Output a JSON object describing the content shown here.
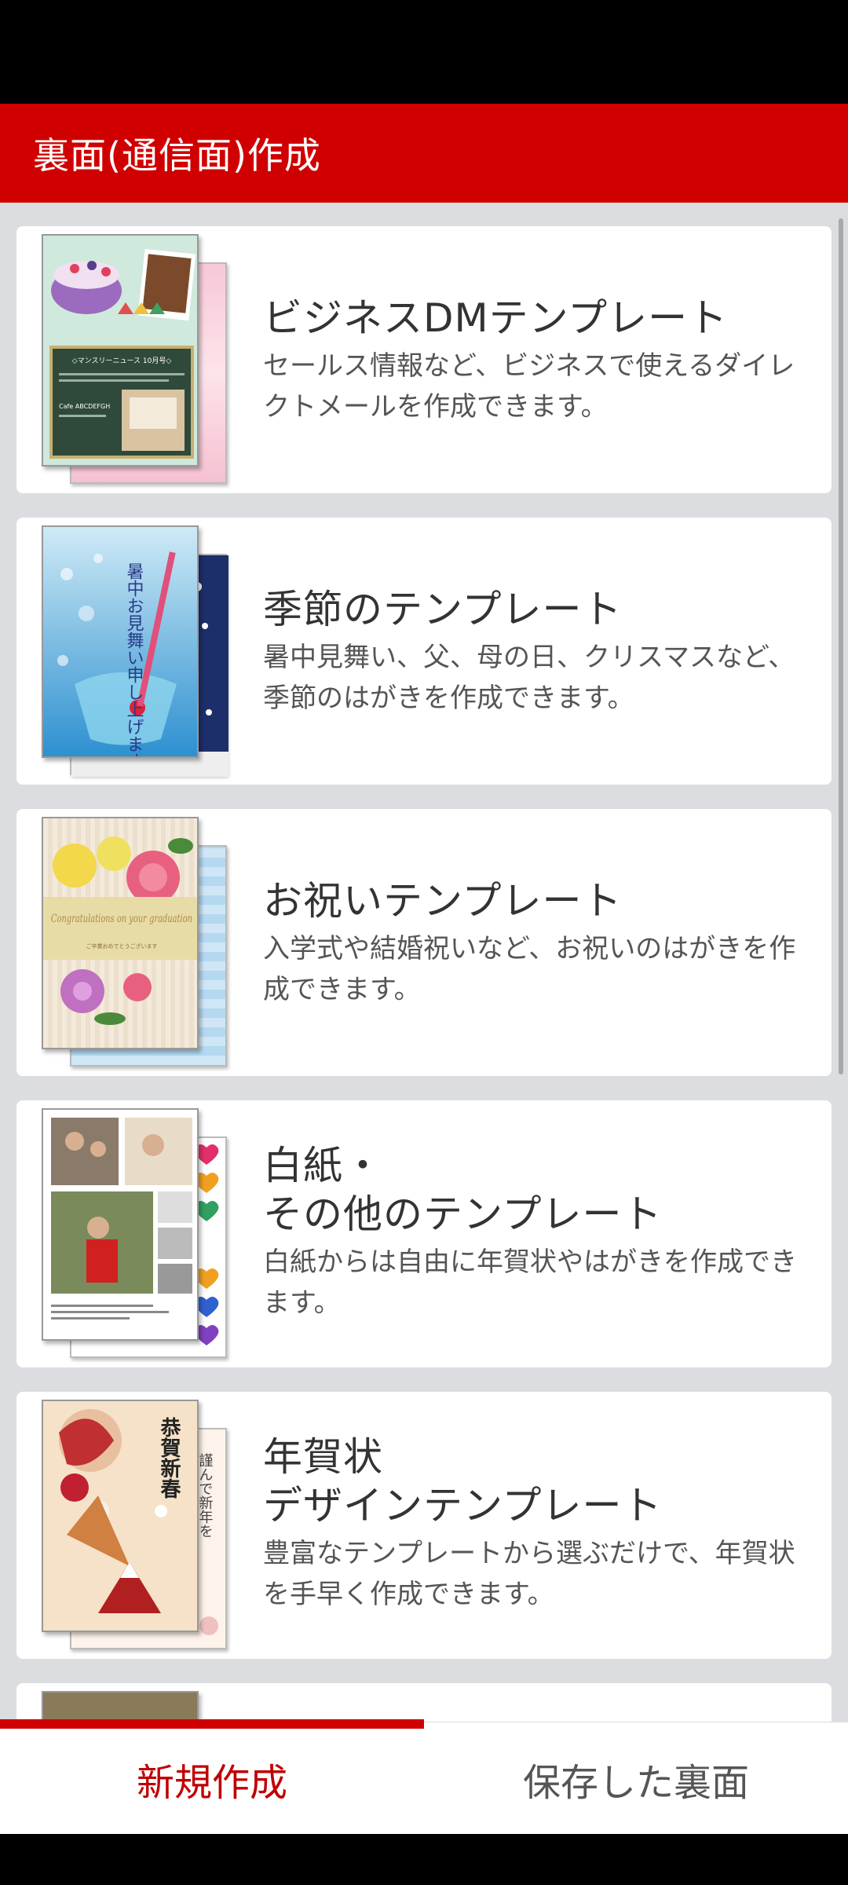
{
  "app_bar": {
    "title": "裏面(通信面)作成"
  },
  "colors": {
    "brand_red": "#d00000",
    "background": "#dcdde1"
  },
  "templates": [
    {
      "title": "ビジネスDMテンプレート",
      "description": "セールス情報など、ビジネスで使えるダイレクトメールを作成できます。",
      "thumb_text": {
        "heading": "◇マンスリーニュース 10月号◇",
        "cafe": "Cafe ABCDEFGH"
      }
    },
    {
      "title": "季節のテンプレート",
      "description": "暑中見舞い、父、母の日、クリスマスなど、季節のはがきを作成できます。",
      "thumb_text": {
        "heading": "暑中お見舞い申し上げます"
      }
    },
    {
      "title": "お祝いテンプレート",
      "description": "入学式や結婚祝いなど、お祝いのはがきを作成できます。",
      "thumb_text": {
        "heading": "Congratulations on your graduation",
        "sub": "ご卒業おめでとうございます"
      }
    },
    {
      "title": "白紙・\nその他のテンプレート",
      "description": "白紙からは自由に年賀状やはがきを作成できます。",
      "thumb_text": {}
    },
    {
      "title": "年賀状\nデザインテンプレート",
      "description": "豊富なテンプレートから選ぶだけで、年賀状を手早く作成できます。",
      "thumb_text": {
        "heading": "恭賀新春",
        "back": "謹んで新年を"
      }
    }
  ],
  "bottom_nav": {
    "tabs": [
      {
        "label": "新規作成",
        "active": true
      },
      {
        "label": "保存した裏面",
        "active": false
      }
    ]
  }
}
